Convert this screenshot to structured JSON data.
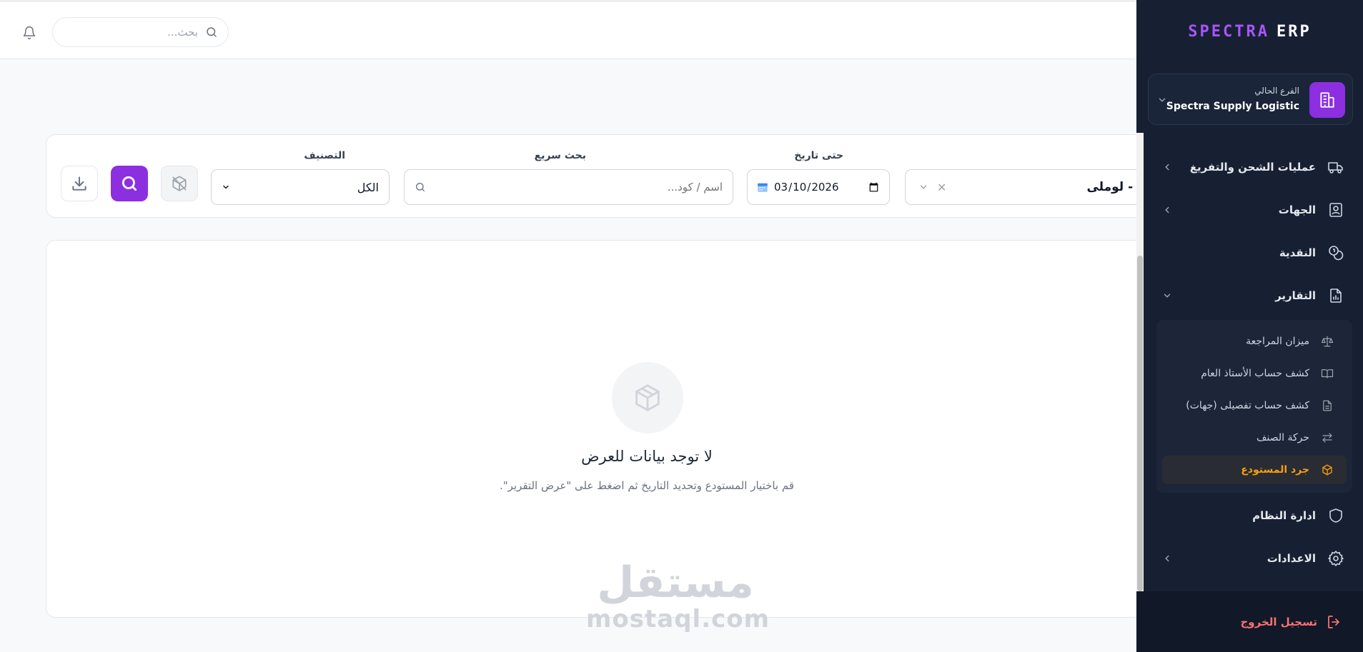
{
  "topbar": {
    "search_placeholder": "بحث..."
  },
  "filters": {
    "warehouse_value": "سى - لوملى",
    "date_label": "حتى تاريخ",
    "date_value": "2026-03-10",
    "quick_search_label": "بحث سريع",
    "quick_search_placeholder": "اسم / كود...",
    "category_label": "التصنيف",
    "category_selected": "الكل"
  },
  "empty_state": {
    "title": "لا توجد بيانات للعرض",
    "subtitle": "قم باختيار المستودع وتحديد التاريخ ثم اضغط على \"عرض التقرير\"."
  },
  "watermark": {
    "arabic": "مستقل",
    "latin": "mostaql.com"
  },
  "sidebar": {
    "brand_first": "SPECTRA",
    "brand_second": "ERP",
    "branch_label": "الفرع الحالي",
    "branch_name": "Spectra Supply Logistic",
    "nav": [
      {
        "label": "عمليات الشحن والتفريغ",
        "icon": "truck-icon",
        "has_chevron": true
      },
      {
        "label": "الجهات",
        "icon": "contacts-icon",
        "has_chevron": true
      },
      {
        "label": "النقدية",
        "icon": "coins-icon",
        "has_chevron": false
      },
      {
        "label": "التقارير",
        "icon": "report-icon",
        "has_chevron": true,
        "expanded": true
      },
      {
        "label": "ادارة النظام",
        "icon": "shield-icon",
        "has_chevron": false
      },
      {
        "label": "الاعدادات",
        "icon": "gear-icon",
        "has_chevron": true
      }
    ],
    "reports_submenu": [
      {
        "label": "ميزان المراجعة",
        "icon": "scale-icon"
      },
      {
        "label": "كشف حساب الأستاذ العام",
        "icon": "book-icon"
      },
      {
        "label": "كشف حساب تفصيلى (جهات)",
        "icon": "document-icon"
      },
      {
        "label": "حركة الصنف",
        "icon": "swap-icon"
      },
      {
        "label": "جرد المستودع",
        "icon": "package-icon",
        "active": true
      }
    ],
    "logout_label": "تسجيل الخروج"
  },
  "colors": {
    "accent": "#8b2fe0",
    "sidebar_bg": "#172033",
    "active_text": "#f59e0b",
    "logout_text": "#f87171"
  }
}
